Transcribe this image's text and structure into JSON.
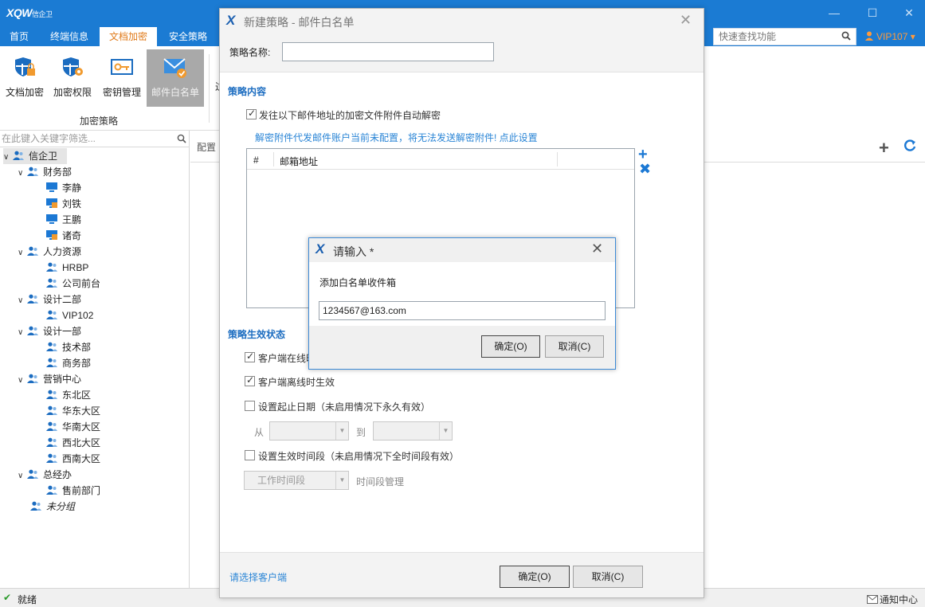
{
  "app": {
    "logo": "XQW",
    "logo_sub": "信企卫",
    "win_min": "—",
    "win_max": "☐",
    "win_close": "✕"
  },
  "nav": {
    "tabs": [
      "首页",
      "终端信息",
      "文档加密",
      "安全策略"
    ],
    "active_index": 2,
    "search_placeholder": "快速查找功能",
    "user": "VIP107 ▾"
  },
  "ribbon": {
    "buttons": [
      "文档加密",
      "加密权限",
      "密钥管理",
      "邮件白名单"
    ],
    "active_index": 3,
    "group_label": "加密策略",
    "partial_next": "过"
  },
  "tree": {
    "filter_placeholder": "在此键入关键字筛选...",
    "root": "信企卫",
    "nodes": [
      {
        "label": "财务部",
        "type": "group",
        "level": 1
      },
      {
        "label": "李静",
        "type": "pc",
        "level": 2
      },
      {
        "label": "刘铁",
        "type": "pc-lock",
        "level": 2
      },
      {
        "label": "王鹏",
        "type": "pc",
        "level": 2
      },
      {
        "label": "诸奇",
        "type": "pc-lock",
        "level": 2
      },
      {
        "label": "人力资源",
        "type": "group",
        "level": 1
      },
      {
        "label": "HRBP",
        "type": "user",
        "level": 2
      },
      {
        "label": "公司前台",
        "type": "user",
        "level": 2
      },
      {
        "label": "设计二部",
        "type": "group",
        "level": 1
      },
      {
        "label": "VIP102",
        "type": "user",
        "level": 2
      },
      {
        "label": "设计一部",
        "type": "group",
        "level": 1
      },
      {
        "label": "技术部",
        "type": "user",
        "level": 2
      },
      {
        "label": "商务部",
        "type": "user",
        "level": 2
      },
      {
        "label": "营销中心",
        "type": "group",
        "level": 1
      },
      {
        "label": "东北区",
        "type": "user",
        "level": 2
      },
      {
        "label": "华东大区",
        "type": "user",
        "level": 2
      },
      {
        "label": "华南大区",
        "type": "user",
        "level": 2
      },
      {
        "label": "西北大区",
        "type": "user",
        "level": 2
      },
      {
        "label": "西南大区",
        "type": "user",
        "level": 2
      },
      {
        "label": "总经办",
        "type": "group",
        "level": 1
      },
      {
        "label": "售前部门",
        "type": "user",
        "level": 2
      },
      {
        "label": "未分组",
        "type": "ungrouped",
        "level": 1
      }
    ]
  },
  "right": {
    "config_label": "配置",
    "add": "+"
  },
  "status": {
    "icon": "✔",
    "text": "就绪",
    "notify": "通知中心"
  },
  "dialog": {
    "title": "新建策略 - 邮件白名单",
    "close": "✕",
    "name_label": "策略名称:",
    "name_value": "",
    "section_content": "策略内容",
    "auto_decrypt": {
      "label": "发往以下邮件地址的加密文件附件自动解密",
      "checked": true
    },
    "warning_link": "解密附件代发邮件账户当前未配置，将无法发送解密附件! 点此设置",
    "grid": {
      "col_index": "#",
      "col_email": "邮箱地址"
    },
    "grid_add": "+",
    "grid_remove": "✖",
    "section_status": "策略生效状态",
    "online": {
      "label": "客户端在线时生效",
      "checked": true
    },
    "offline": {
      "label": "客户端离线时生效",
      "checked": true
    },
    "date_range": {
      "label": "设置起止日期（未启用情况下永久有效）",
      "checked": false,
      "from": "从",
      "to": "到"
    },
    "time_period": {
      "label": "设置生效时间段（未启用情况下全时间段有效）",
      "checked": false,
      "selected": "工作时间段",
      "manage": "时间段管理"
    },
    "select_client": "请选择客户端",
    "ok": "确定(O)",
    "cancel": "取消(C)"
  },
  "input_dialog": {
    "title": "请输入 *",
    "close": "✕",
    "prompt": "添加白名单收件箱",
    "value": "1234567@163.com",
    "ok": "确定(O)",
    "cancel": "取消(C)"
  },
  "colors": {
    "titlebar": "#1b7bd3",
    "accent_orange": "#e07a1a",
    "link_blue": "#2a85d6",
    "section_blue": "#1b6cc0"
  }
}
